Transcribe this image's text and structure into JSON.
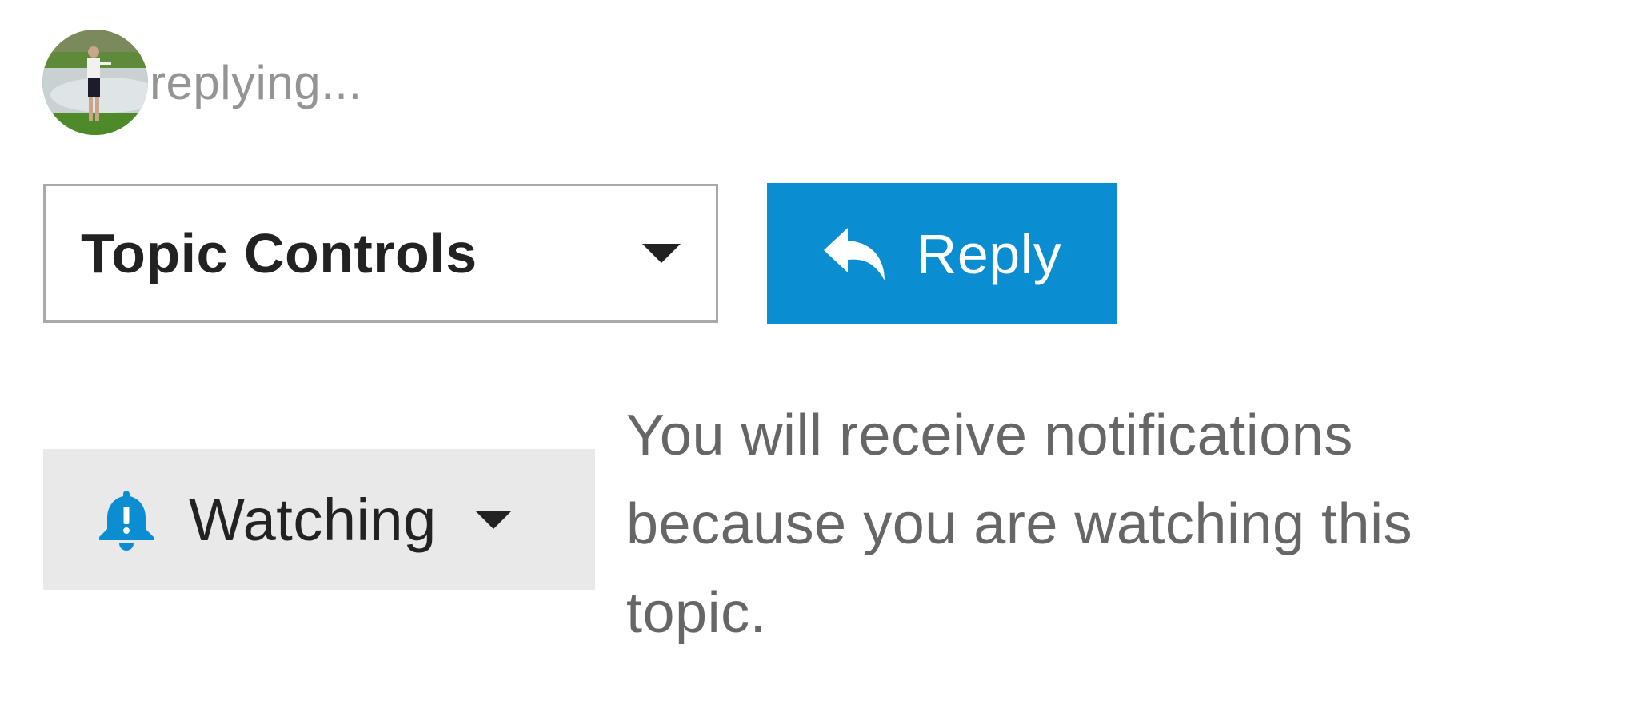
{
  "presence": {
    "status_text": "replying..."
  },
  "topic_controls": {
    "label": "Topic Controls"
  },
  "reply": {
    "label": "Reply",
    "background_color": "#0a8ed1"
  },
  "notifications": {
    "level_label": "Watching",
    "reason_text": "You will receive notifications because you are watching this topic.",
    "bell_color": "#0a8ed1"
  },
  "icons": {
    "avatar": "user-avatar",
    "reply": "reply-arrow-icon",
    "bell": "bell-icon",
    "caret": "chevron-down-icon"
  }
}
